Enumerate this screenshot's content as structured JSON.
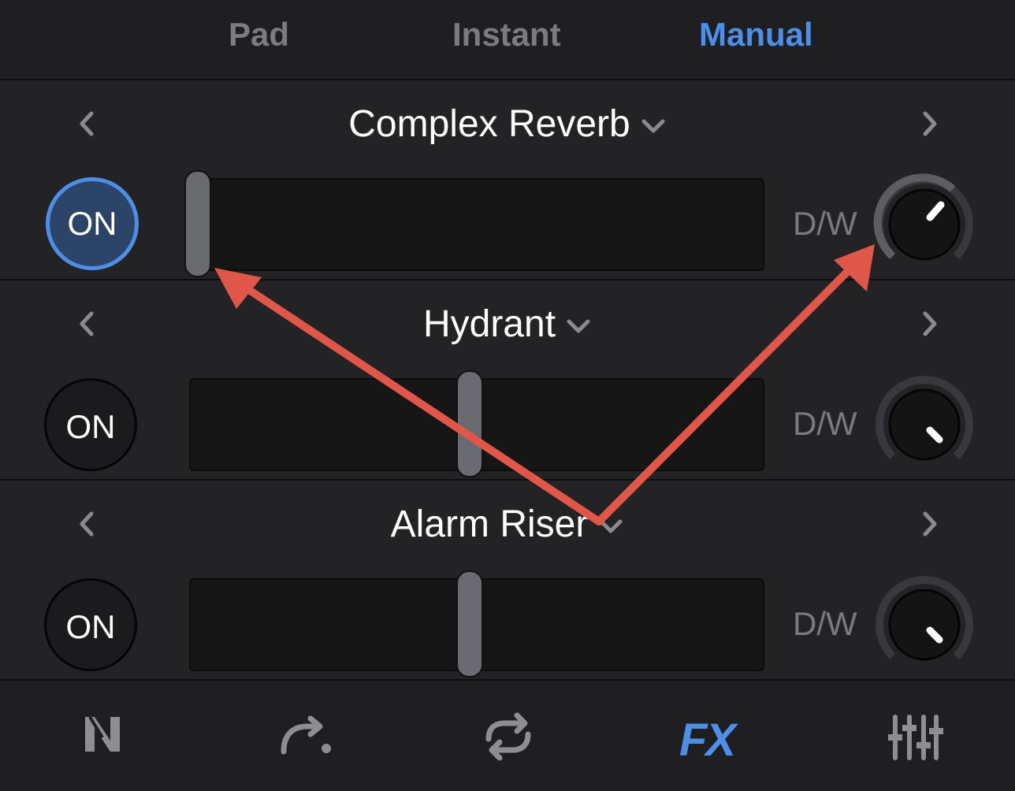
{
  "tabs": [
    {
      "label": "Pad",
      "active": false
    },
    {
      "label": "Instant",
      "active": false
    },
    {
      "label": "Manual",
      "active": true
    }
  ],
  "fx_rows": [
    {
      "name": "Complex Reverb",
      "on_label": "ON",
      "on_active": true,
      "slider_value": 0.0,
      "dw_label": "D/W",
      "knob_value": 0.85
    },
    {
      "name": "Hydrant",
      "on_label": "ON",
      "on_active": false,
      "slider_value": 0.5,
      "dw_label": "D/W",
      "knob_value": 0.5
    },
    {
      "name": "Alarm Riser",
      "on_label": "ON",
      "on_active": false,
      "slider_value": 0.5,
      "dw_label": "D/W",
      "knob_value": 0.5
    }
  ],
  "bottom_bar": {
    "fx_label": "FX",
    "icons": [
      "rekordbox-n-icon",
      "redo-arrow-icon",
      "loop-icon",
      "fx-icon",
      "mixer-sliders-icon"
    ],
    "active": "fx-icon"
  },
  "colors": {
    "accent": "#4d8fe8",
    "annotation": "#e0574a",
    "background": "#1f1f21"
  }
}
